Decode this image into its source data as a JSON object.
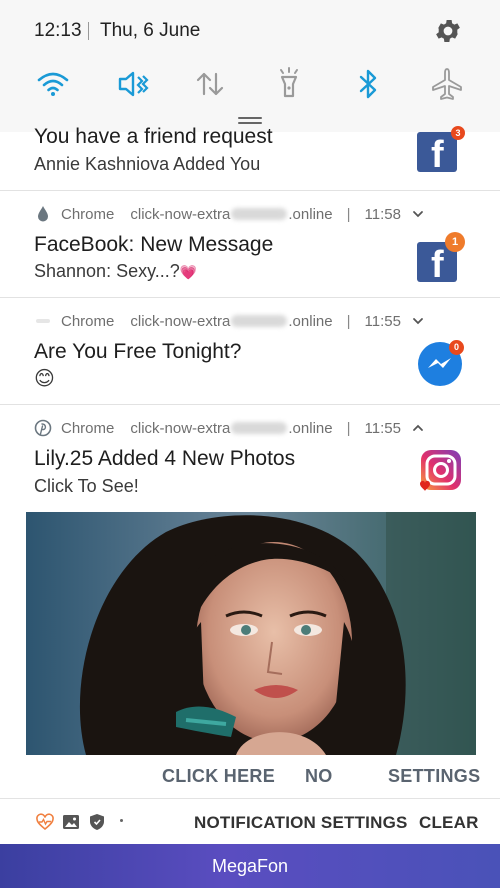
{
  "status": {
    "time": "12:13",
    "date": "Thu, 6 June"
  },
  "quick_settings": [
    {
      "icon": "wifi-icon",
      "active": true
    },
    {
      "icon": "sound-mute-icon",
      "active": true
    },
    {
      "icon": "mobile-data-icon",
      "active": false
    },
    {
      "icon": "flashlight-icon",
      "active": false
    },
    {
      "icon": "bluetooth-icon",
      "active": true
    },
    {
      "icon": "airplane-mode-icon",
      "active": false
    }
  ],
  "colors": {
    "accent": "#1a9ad6",
    "inactive": "#9a9a9a",
    "facebook": "#3b5998",
    "messenger": "#1e7fe0",
    "badge": "#e8491d"
  },
  "notifications": [
    {
      "title": "You have a friend request",
      "text": "Annie Kashniova Added You",
      "icon": "facebook-icon",
      "badge": "3"
    },
    {
      "app": "Chrome",
      "url_prefix": "click-now-extra",
      "url_suffix": ".online",
      "time": "11:58",
      "app_icon": "chrome-drop-icon",
      "title": "FaceBook: New Message",
      "text": "Shannon: Sexy...?",
      "emoji": "💗",
      "icon": "facebook-icon",
      "badge": "1"
    },
    {
      "app": "Chrome",
      "url_prefix": "click-now-extra",
      "url_suffix": ".online",
      "time": "11:55",
      "app_icon": "chrome-ghost-icon",
      "title": "Are You Free Tonight?",
      "emoji": "😊",
      "icon": "messenger-icon",
      "badge": "0"
    },
    {
      "app": "Chrome",
      "url_prefix": "click-now-extra",
      "url_suffix": ".online",
      "time": "11:55",
      "app_icon": "pinterest-icon",
      "title": "Lily.25 Added 4 New Photos",
      "text": "Click To See!",
      "icon": "instagram-icon",
      "actions": [
        "CLICK HERE",
        "NO",
        "SETTINGS"
      ]
    }
  ],
  "footer": {
    "icons": [
      "health-icon",
      "gallery-icon",
      "security-icon"
    ],
    "notification_settings": "NOTIFICATION SETTINGS",
    "clear": "CLEAR"
  },
  "carrier": "MegaFon"
}
